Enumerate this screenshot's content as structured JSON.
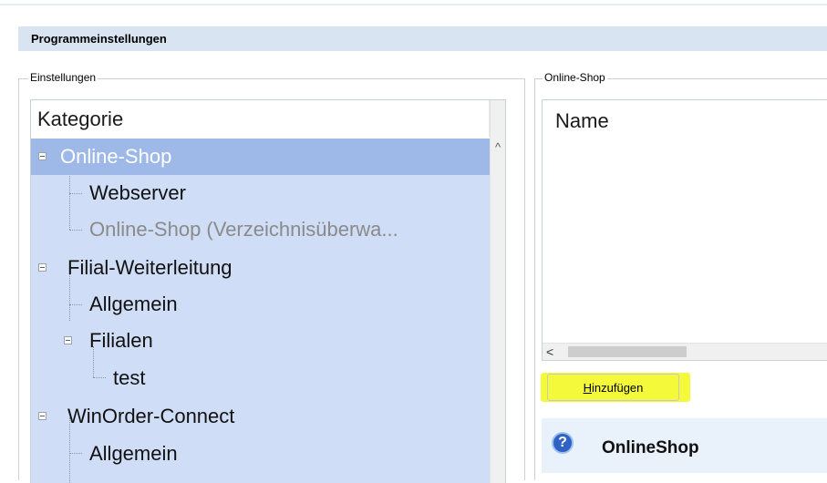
{
  "header": {
    "title": "Programmeinstellungen"
  },
  "left_group": {
    "legend": "Einstellungen",
    "tree": {
      "column_header": "Kategorie",
      "rows": [
        {
          "label": "Online-Shop",
          "state": "selected"
        },
        {
          "label": "Webserver"
        },
        {
          "label": "Online-Shop (Verzeichnisüberwa...",
          "state": "muted"
        },
        {
          "label": "Filial-Weiterleitung"
        },
        {
          "label": "Allgemein"
        },
        {
          "label": "Filialen"
        },
        {
          "label": "test"
        },
        {
          "label": "WinOrder-Connect"
        },
        {
          "label": "Allgemein"
        }
      ],
      "scroll_up_glyph": "^"
    }
  },
  "right_group": {
    "legend": "Online-Shop",
    "list": {
      "column_header": "Name",
      "scroll_left_glyph": "<"
    },
    "add_button": {
      "accel": "H",
      "rest": "inzufügen"
    },
    "info": {
      "icon": "?",
      "title": "OnlineShop"
    }
  },
  "colors": {
    "selection": "#9eb8e8",
    "tree_background": "#cfddf6",
    "highlight": "#f4f93a",
    "header_bar": "#d9e4f2"
  }
}
